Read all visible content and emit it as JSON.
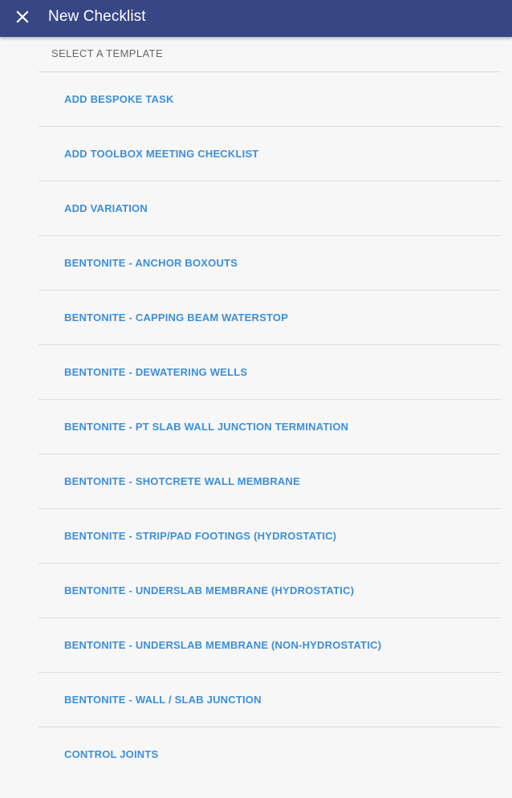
{
  "header": {
    "title": "New Checklist",
    "close_icon": "close-icon",
    "background_color": "#374684"
  },
  "section": {
    "label": "SELECT A TEMPLATE"
  },
  "templates": [
    "ADD BESPOKE TASK",
    "ADD TOOLBOX MEETING CHECKLIST",
    "ADD VARIATION",
    "BENTONITE - ANCHOR BOXOUTS",
    "BENTONITE - CAPPING BEAM WATERSTOP",
    "BENTONITE - DEWATERING WELLS",
    "BENTONITE - PT SLAB WALL JUNCTION TERMINATION",
    "BENTONITE - SHOTCRETE WALL MEMBRANE",
    "BENTONITE - STRIP/PAD FOOTINGS (HYDROSTATIC)",
    "BENTONITE - UNDERSLAB MEMBRANE (HYDROSTATIC)",
    "BENTONITE - UNDERSLAB MEMBRANE (NON-HYDROSTATIC)",
    "BENTONITE - WALL / SLAB JUNCTION",
    "CONTROL JOINTS"
  ],
  "colors": {
    "link": "#3d8fd6",
    "divider": "#dcdcdc",
    "page_background": "#f7f7f7"
  }
}
